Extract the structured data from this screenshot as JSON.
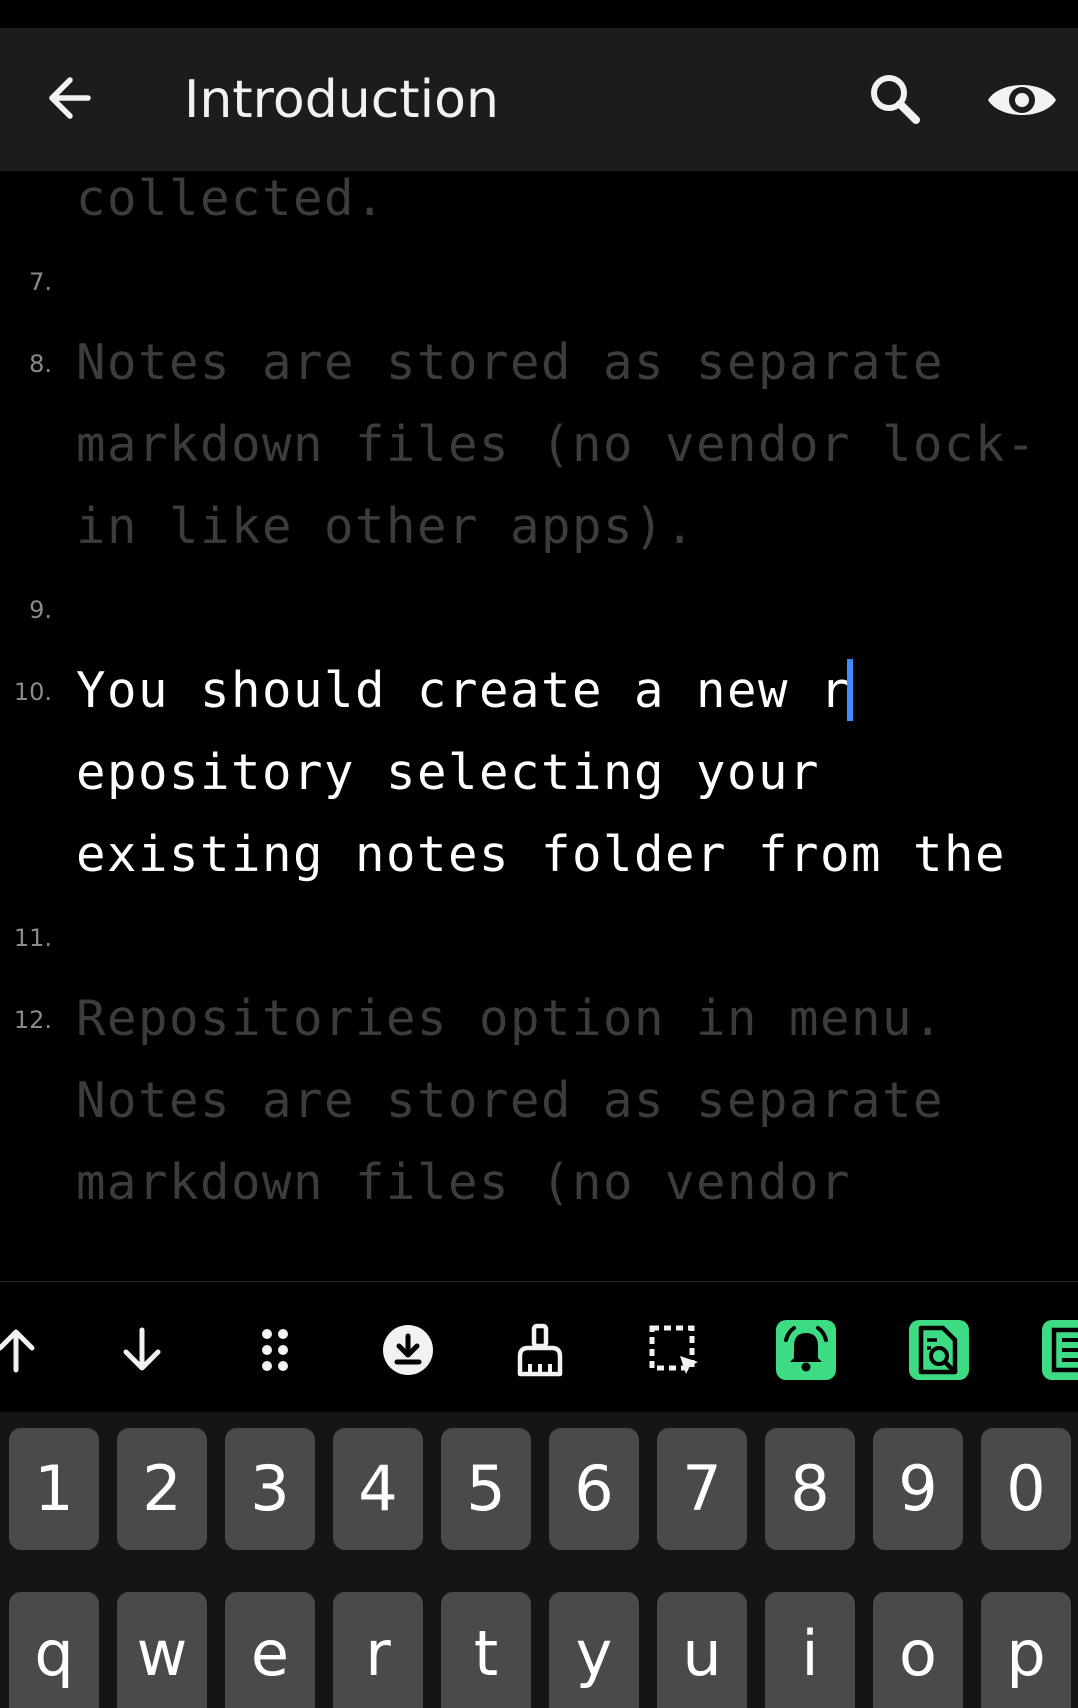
{
  "app_bar": {
    "title": "Introduction",
    "back_icon": "arrow-left-icon",
    "search_icon": "search-icon",
    "preview_icon": "eye-icon"
  },
  "editor": {
    "lines": [
      {
        "number": "",
        "text": "permissions. No user data is collected.",
        "state": "dim"
      },
      {
        "number": "7.",
        "text": "",
        "state": "dim"
      },
      {
        "number": "8.",
        "text": "Notes are stored as separate markdown files (no vendor lock-in like other apps).",
        "state": "dim"
      },
      {
        "number": "9.",
        "text": "",
        "state": "dim"
      },
      {
        "number": "10.",
        "text_before_cursor": "You should create a new r",
        "text_after_cursor": "epository selecting your existing notes folder from the",
        "state": "active"
      },
      {
        "number": "11.",
        "text": "",
        "state": "dim"
      },
      {
        "number": "12.",
        "text": "Repositories option in menu. Notes are stored as separate markdown files (no vendor",
        "state": "dim"
      }
    ],
    "cursor_color": "#3d8bfd"
  },
  "toolbar": {
    "items": [
      {
        "icon": "arrow-up-icon",
        "highlight": false
      },
      {
        "icon": "arrow-down-icon",
        "highlight": false
      },
      {
        "icon": "grid-dots-icon",
        "highlight": false
      },
      {
        "icon": "download-circle-icon",
        "highlight": false
      },
      {
        "icon": "broom-icon",
        "highlight": false
      },
      {
        "icon": "select-area-icon",
        "highlight": false
      },
      {
        "icon": "alarm-bell-icon",
        "highlight": true
      },
      {
        "icon": "document-search-icon",
        "highlight": true
      },
      {
        "icon": "list-document-icon",
        "highlight": true
      }
    ],
    "highlight_color": "#3ddc84"
  },
  "keyboard": {
    "number_row": [
      "1",
      "2",
      "3",
      "4",
      "5",
      "6",
      "7",
      "8",
      "9",
      "0"
    ],
    "letter_row": [
      "q",
      "w",
      "e",
      "r",
      "t",
      "y",
      "u",
      "i",
      "o",
      "p"
    ]
  }
}
